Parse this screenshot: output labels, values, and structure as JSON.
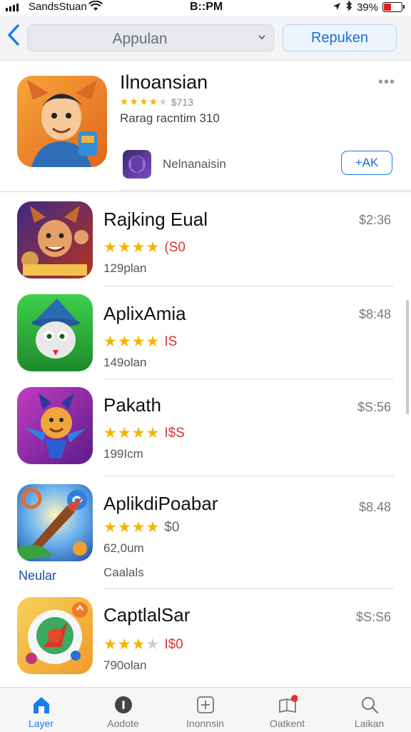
{
  "status_bar": {
    "carrier": "SandsStuan",
    "time": "B::PM",
    "battery": "39%",
    "battery_level": 0.39
  },
  "nav": {
    "back_icon": "chevron-left-icon",
    "search_label": "Appulan",
    "button_label": "Repuken"
  },
  "featured": {
    "title": "Ilnoansian",
    "rating_text": "★★★★ ★★★ $713",
    "rating_value": "$713",
    "stars": 4,
    "subtitle": "Rarag racntim 310",
    "mini_label": "Nelnanaisin",
    "get_label": "+AK"
  },
  "apps": [
    {
      "title": "Rajking Eual",
      "stars": 4,
      "rating": "(S0",
      "sub": "129plan",
      "price": "$2:36"
    },
    {
      "title": "AplixAmia",
      "stars": 4,
      "rating": "IS",
      "sub": "149olan",
      "price": "$8:48"
    },
    {
      "title": "Pakath",
      "stars": 4,
      "rating": "I$S",
      "sub": "199Icm",
      "price": "$S:56"
    },
    {
      "title": "AplikdiPoabar",
      "stars": 4,
      "rating": "$0",
      "sub": "62,0um",
      "extra": "Caalals",
      "label_under_icon": "Neular",
      "price": "$8.48"
    },
    {
      "title": "CaptlalSar",
      "stars": 3.5,
      "rating": "I$0",
      "sub": "790olan",
      "price": "$S:S6"
    }
  ],
  "tabs": [
    {
      "label": "Layer",
      "icon": "home-icon",
      "active": true
    },
    {
      "label": "Aodote",
      "icon": "info-icon",
      "active": false
    },
    {
      "label": "Inonnsin",
      "icon": "plus-square-icon",
      "active": false
    },
    {
      "label": "Oatkent",
      "icon": "book-badge-icon",
      "active": false
    },
    {
      "label": "Laikan",
      "icon": "search-icon",
      "active": false
    }
  ]
}
